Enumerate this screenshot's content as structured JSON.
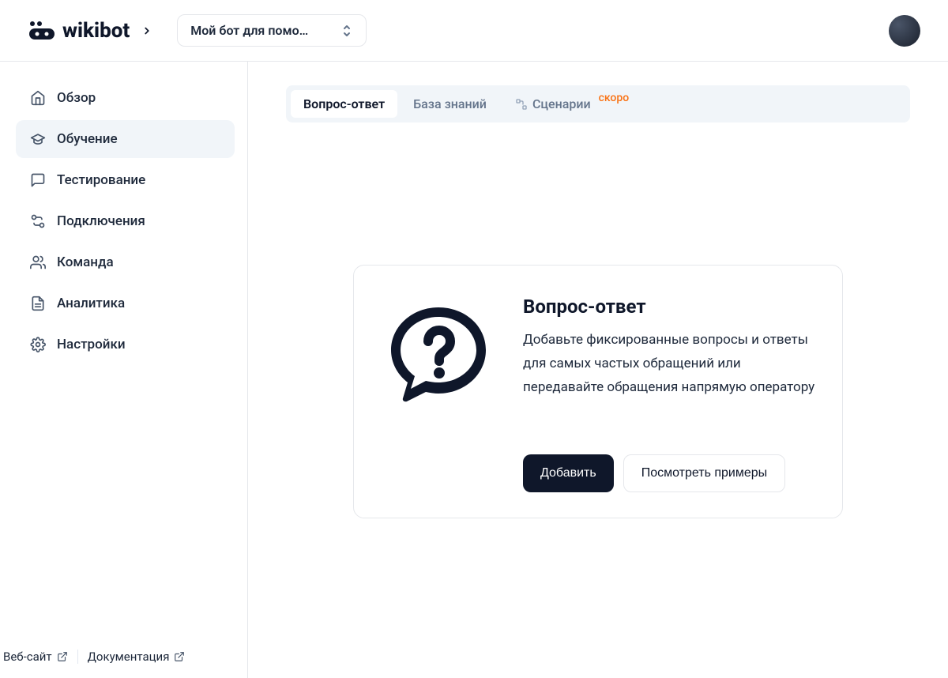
{
  "header": {
    "logo_text": "wikibot",
    "bot_selector_label": "Мой бот для помо…"
  },
  "sidebar": {
    "items": [
      {
        "label": "Обзор"
      },
      {
        "label": "Обучение"
      },
      {
        "label": "Тестирование"
      },
      {
        "label": "Подключения"
      },
      {
        "label": "Команда"
      },
      {
        "label": "Аналитика"
      },
      {
        "label": "Настройки"
      }
    ],
    "footer": {
      "website": "Веб-сайт",
      "docs": "Документация"
    }
  },
  "tabs": {
    "items": [
      {
        "label": "Вопрос-ответ"
      },
      {
        "label": "База знаний"
      },
      {
        "label": "Сценарии",
        "badge": "скоро"
      }
    ]
  },
  "empty_state": {
    "title": "Вопрос-ответ",
    "description": "Добавьте фиксированные вопросы и ответы для самых частых обращений или передавайте обращения напрямую оператору",
    "add_button": "Добавить",
    "examples_button": "Посмотреть примеры"
  }
}
